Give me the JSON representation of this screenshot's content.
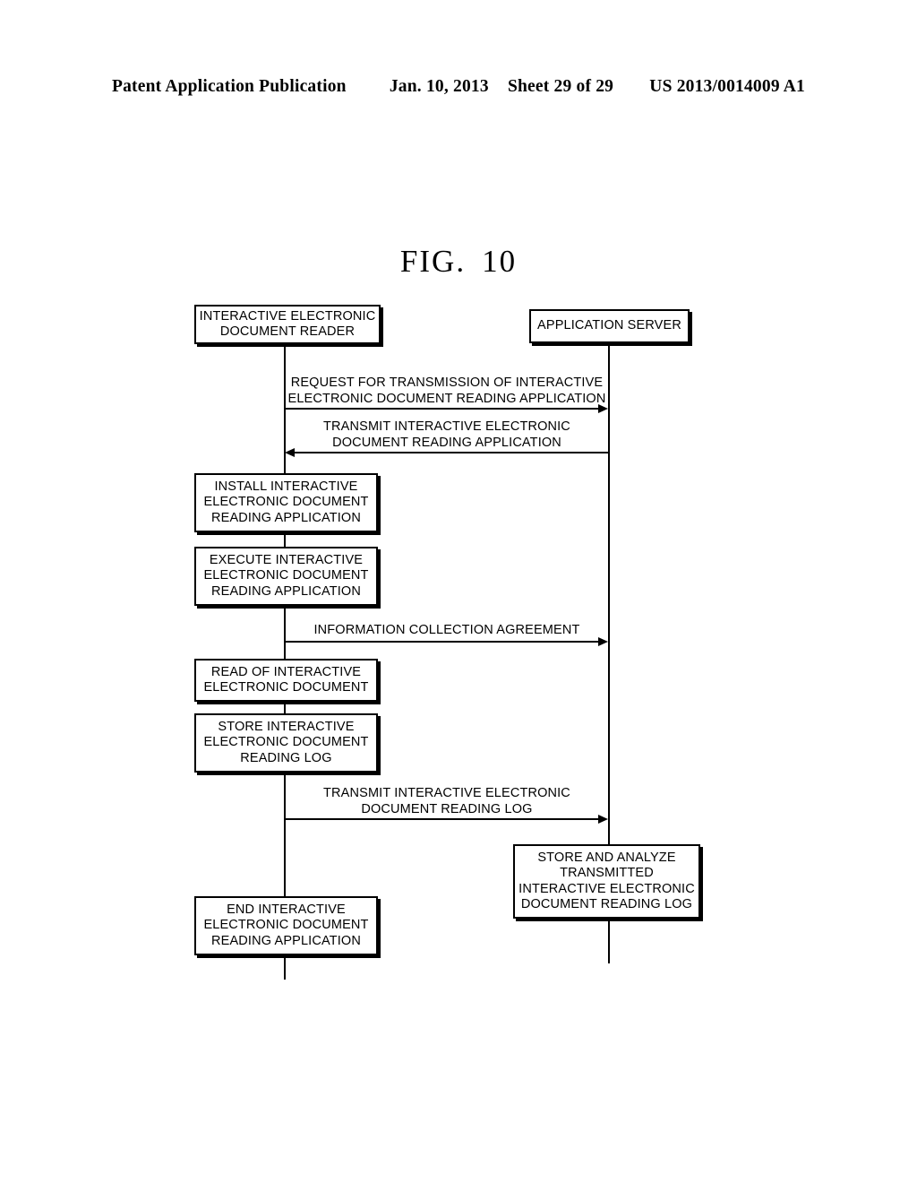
{
  "header": {
    "publication": "Patent Application Publication",
    "date": "Jan. 10, 2013",
    "sheet": "Sheet 29 of 29",
    "patent_number": "US 2013/0014009 A1"
  },
  "figure": {
    "label": "FIG.",
    "number": "10"
  },
  "diagram": {
    "type": "sequence-diagram",
    "lifelines": [
      {
        "id": "reader",
        "title": "INTERACTIVE ELECTRONIC\nDOCUMENT READER"
      },
      {
        "id": "server",
        "title": "APPLICATION SERVER"
      }
    ],
    "messages": [
      {
        "id": "msg-request-transmission",
        "label": "REQUEST FOR TRANSMISSION OF INTERACTIVE\nELECTRONIC DOCUMENT READING APPLICATION",
        "from": "reader",
        "to": "server",
        "direction": "right"
      },
      {
        "id": "msg-transmit-application",
        "label": "TRANSMIT INTERACTIVE ELECTRONIC\nDOCUMENT READING APPLICATION",
        "from": "server",
        "to": "reader",
        "direction": "left"
      },
      {
        "id": "msg-information-collection-agreement",
        "label": "INFORMATION COLLECTION AGREEMENT",
        "from": "reader",
        "to": "server",
        "direction": "right"
      },
      {
        "id": "msg-transmit-reading-log",
        "label": "TRANSMIT INTERACTIVE ELECTRONIC\nDOCUMENT READING LOG",
        "from": "reader",
        "to": "server",
        "direction": "right"
      }
    ],
    "reader_steps": [
      {
        "id": "install-application",
        "label": "INSTALL INTERACTIVE\nELECTRONIC DOCUMENT\nREADING APPLICATION"
      },
      {
        "id": "execute-application",
        "label": "EXECUTE INTERACTIVE\nELECTRONIC DOCUMENT\nREADING APPLICATION"
      },
      {
        "id": "read-document",
        "label": "READ OF INTERACTIVE\nELECTRONIC DOCUMENT"
      },
      {
        "id": "store-reading-log",
        "label": "STORE INTERACTIVE\nELECTRONIC DOCUMENT\nREADING LOG"
      },
      {
        "id": "end-application",
        "label": "END INTERACTIVE\nELECTRONIC DOCUMENT\nREADING APPLICATION"
      }
    ],
    "server_steps": [
      {
        "id": "store-and-analyze-log",
        "label": "STORE AND ANALYZE\nTRANSMITTED\nINTERACTIVE ELECTRONIC\nDOCUMENT READING LOG"
      }
    ]
  }
}
